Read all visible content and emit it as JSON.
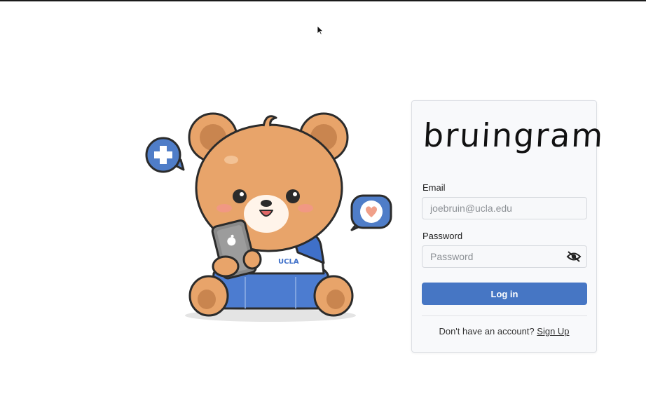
{
  "app": {
    "logo_text": "bruingram",
    "illustration_badge": "UCLA"
  },
  "login_form": {
    "email_label": "Email",
    "email_placeholder": "joebruin@ucla.edu",
    "password_label": "Password",
    "password_placeholder": "Password",
    "login_button": "Log in",
    "signup_prompt": "Don't have an account?",
    "signup_link": "Sign Up"
  },
  "icons": {
    "password_toggle": "eye-slash-icon",
    "cursor": "mouse-pointer-icon"
  },
  "colors": {
    "primary": "#4676c4",
    "bear": "#e8a46a",
    "shirt_blue": "#3f70c9"
  }
}
